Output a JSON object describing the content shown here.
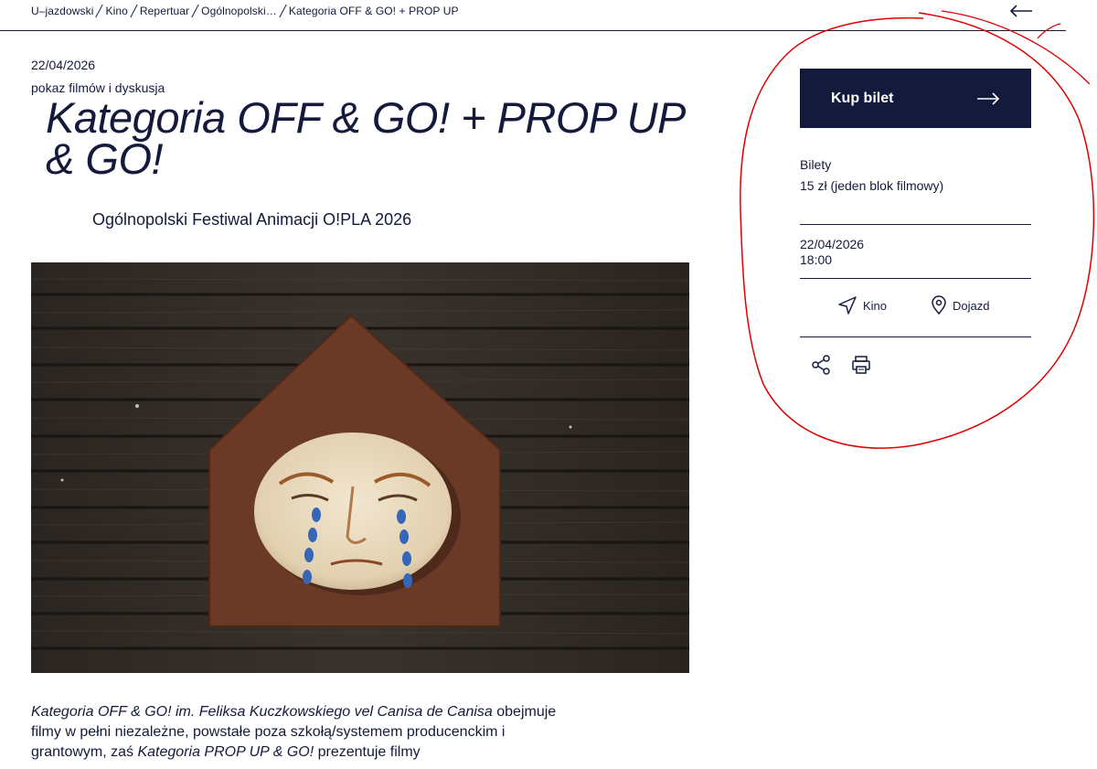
{
  "breadcrumb": {
    "items": [
      "U–jazdowski",
      "Kino",
      "Repertuar",
      "Ogólnopolski…",
      "Kategoria OFF & GO! + PROP UP"
    ]
  },
  "event": {
    "date": "22/04/2026",
    "type": "pokaz filmów i dyskusja",
    "title": "Kategoria OFF & GO! + PROP UP & GO!",
    "festival": "Ogólnopolski Festiwal Animacji O!PLA 2026"
  },
  "description": {
    "part1": "Kategoria OFF & GO! im. Feliksa Kuczkowskiego vel Canisa de Canisa",
    "part2": " obejmuje filmy w pełni niezależne, powstałe poza szkołą/systemem producenckim i grantowym, zaś ",
    "part3": "Kategoria PROP UP & GO!",
    "part4": " prezentuje filmy"
  },
  "sidebar": {
    "buy_label": "Kup bilet",
    "tickets_heading": "Bilety",
    "tickets_price": "15 zł (jeden blok filmowy)",
    "date": "22/04/2026",
    "time": "18:00",
    "venue_label": "Kino",
    "directions_label": "Dojazd"
  },
  "icons": {
    "back": "arrow-left-icon",
    "buy": "arrow-right-icon",
    "venue": "navigation-arrow-icon",
    "directions": "map-pin-icon",
    "share": "share-icon",
    "print": "printer-icon"
  },
  "colors": {
    "navy": "#131a3c",
    "annotation": "#e00000"
  }
}
